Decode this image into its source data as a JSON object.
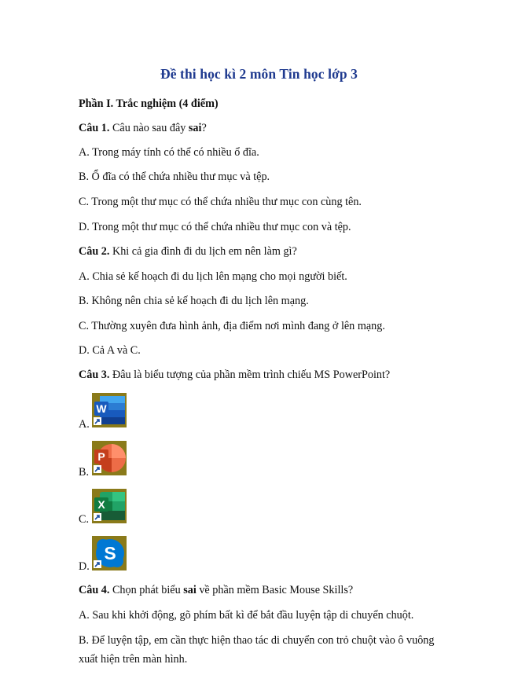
{
  "title": "Đề thi học kì 2 môn Tin học lớp 3",
  "section1": "Phần I. Trắc nghiệm (4 điểm)",
  "q1": {
    "label": "Câu 1.",
    "text_before": " Câu nào sau đây ",
    "emph": "sai",
    "text_after": "?",
    "options": [
      "A. Trong máy tính có thể có nhiều ổ đĩa.",
      "B. Ổ đĩa có thể chứa nhiều thư mục và tệp.",
      "C. Trong một thư mục có thể chứa nhiều thư mục con cùng tên.",
      "D. Trong một thư mục có thể chứa nhiều thư mục con và tệp."
    ]
  },
  "q2": {
    "label": "Câu 2.",
    "text": " Khi cả gia đình đi du lịch em nên làm gì?",
    "options": [
      "A. Chia sẻ kế hoạch đi du lịch lên mạng cho mọi người biết.",
      "B. Không nên chia sẻ kế hoạch đi du lịch lên mạng.",
      "C. Thường xuyên đưa hình ảnh, địa điểm nơi mình đang ở lên mạng.",
      "D. Cả A và C."
    ]
  },
  "q3": {
    "label": "Câu 3.",
    "text": " Đâu là biểu tượng của phần mềm trình chiếu MS PowerPoint?",
    "options": [
      {
        "letter": "A.",
        "icon": "word-icon",
        "glyph": "W",
        "color": "#185abd"
      },
      {
        "letter": "B.",
        "icon": "powerpoint-icon",
        "glyph": "P",
        "color": "#c43e1c"
      },
      {
        "letter": "C.",
        "icon": "excel-icon",
        "glyph": "X",
        "color": "#107c41"
      },
      {
        "letter": "D.",
        "icon": "skype-icon",
        "glyph": "S",
        "color": "#0078d4"
      }
    ]
  },
  "q4": {
    "label": "Câu 4.",
    "text_before": " Chọn phát biểu ",
    "emph": "sai",
    "text_after": " về phần mềm Basic Mouse Skills?",
    "options": [
      "A. Sau khi khởi động, gõ phím bất kì để bắt đầu luyện tập di chuyển chuột.",
      "B. Để luyện tập, em cần thực hiện thao tác di chuyển con trỏ chuột vào ô vuông",
      "xuất hiện trên màn hình."
    ]
  },
  "colors": {
    "title": "#1f3a8f",
    "icon_bg": "#8a7a1a"
  }
}
